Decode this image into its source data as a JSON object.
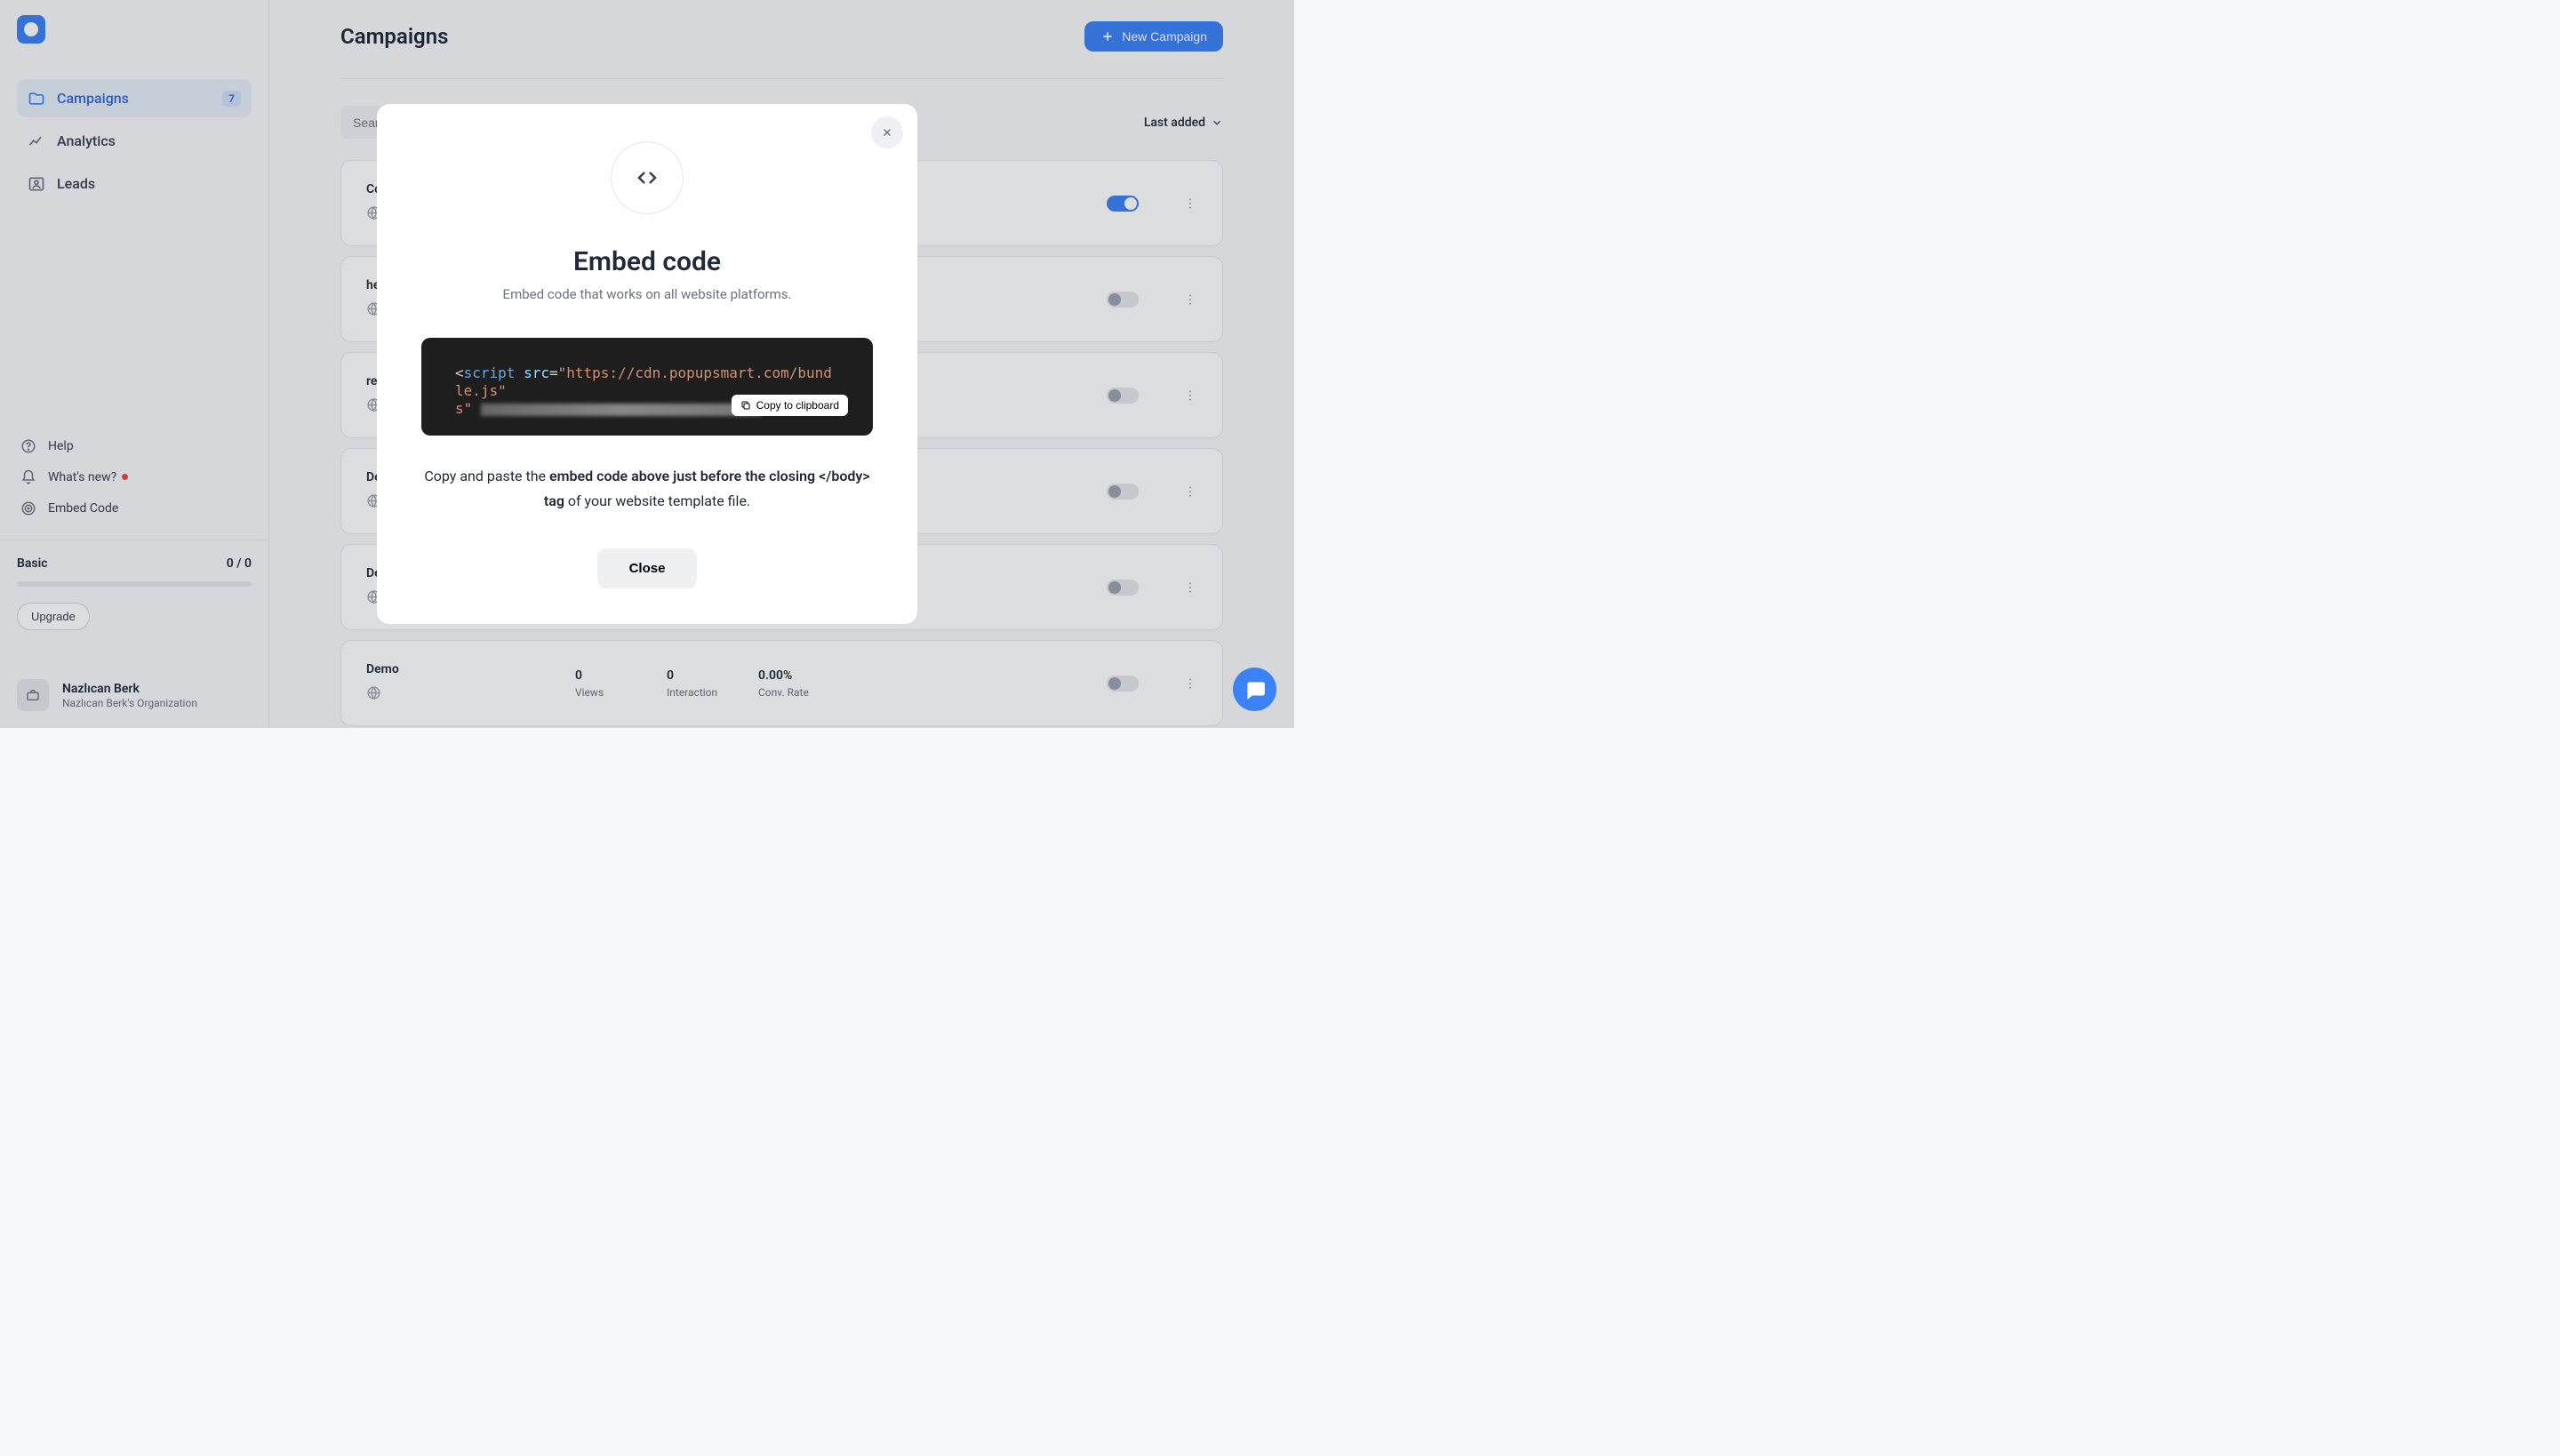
{
  "sidebar": {
    "nav": [
      {
        "label": "Campaigns",
        "badge": "7",
        "active": true
      },
      {
        "label": "Analytics"
      },
      {
        "label": "Leads"
      }
    ],
    "help": [
      {
        "label": "Help"
      },
      {
        "label": "What's new?",
        "dot": true
      },
      {
        "label": "Embed Code"
      }
    ],
    "plan": {
      "name": "Basic",
      "usage": "0 / 0",
      "upgrade": "Upgrade"
    },
    "user": {
      "name": "Nazlıcan Berk",
      "org": "Nazlıcan Berk's Organization"
    }
  },
  "main": {
    "title": "Campaigns",
    "new_btn": "New Campaign",
    "search_placeholder": "Search",
    "sort_label": "Last added",
    "campaigns": [
      {
        "name": "Co",
        "views": "",
        "interaction": "",
        "rate": "",
        "on": true
      },
      {
        "name": "he",
        "views": "",
        "interaction": "",
        "rate": "",
        "on": false
      },
      {
        "name": "re",
        "views": "",
        "interaction": "",
        "rate": "",
        "on": false
      },
      {
        "name": "De",
        "views": "",
        "interaction": "",
        "rate": "",
        "on": false
      },
      {
        "name": "De",
        "views": "",
        "interaction": "",
        "rate": "",
        "on": false
      },
      {
        "name": "Demo",
        "views": "0",
        "interaction": "0",
        "rate": "0.00%",
        "on": false
      }
    ],
    "stat_labels": {
      "views": "Views",
      "interaction": "Interaction",
      "rate": "Conv. Rate"
    }
  },
  "modal": {
    "title": "Embed code",
    "subtitle": "Embed code that works on all website platforms.",
    "code_prefix": "<script src=",
    "code_url": "\"https://cdn.popupsmart.com/bundle.js\"",
    "copy_btn": "Copy to clipboard",
    "instruction_pre": "Copy and paste the ",
    "instruction_bold": "embed code above just before the closing </body> tag",
    "instruction_post": " of your website template file.",
    "close_btn": "Close"
  }
}
